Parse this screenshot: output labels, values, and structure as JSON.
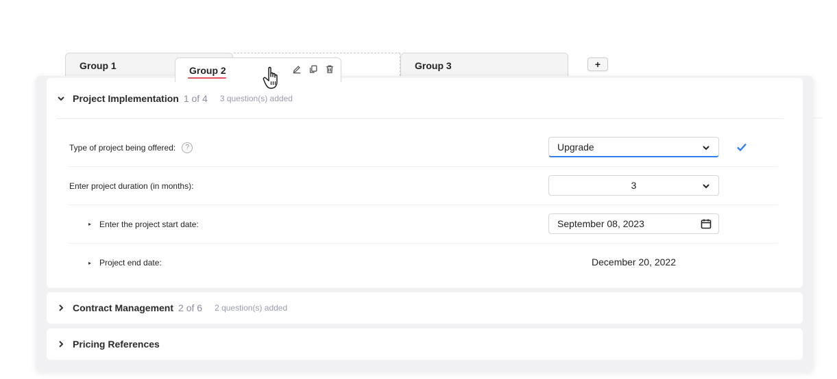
{
  "tabs": [
    {
      "label": "Group 1"
    },
    {
      "label": "Group 2",
      "active": true
    },
    {
      "label": "Group 3"
    }
  ],
  "add_tab_label": "+",
  "sections": [
    {
      "title": "Project Implementation",
      "count": "1 of 4",
      "added": "3 question(s) added",
      "expanded": true,
      "questions": [
        {
          "label": "Type of project being offered:",
          "help": "?",
          "value": "Upgrade",
          "control": "select",
          "validated": true
        },
        {
          "label": "Enter project duration (in months):",
          "value": "3",
          "control": "select"
        },
        {
          "label": "Enter the project start date:",
          "bullet": "▸",
          "value": "September 08, 2023",
          "control": "date"
        },
        {
          "label": "Project end date:",
          "bullet": "▸",
          "value": "December 20, 2022",
          "control": "static"
        }
      ]
    },
    {
      "title": "Contract Management",
      "count": "2 of 6",
      "added": "2 question(s) added",
      "expanded": false
    },
    {
      "title": "Pricing References",
      "expanded": false
    }
  ],
  "icons": {
    "edit": "pencil-icon",
    "copy": "copy-icon",
    "delete": "trash-icon",
    "check": "check-icon",
    "calendar": "calendar-icon"
  },
  "colors": {
    "accent": "#2f80ed",
    "tab_underline": "#e2535b",
    "muted_text": "#8b8da3"
  }
}
